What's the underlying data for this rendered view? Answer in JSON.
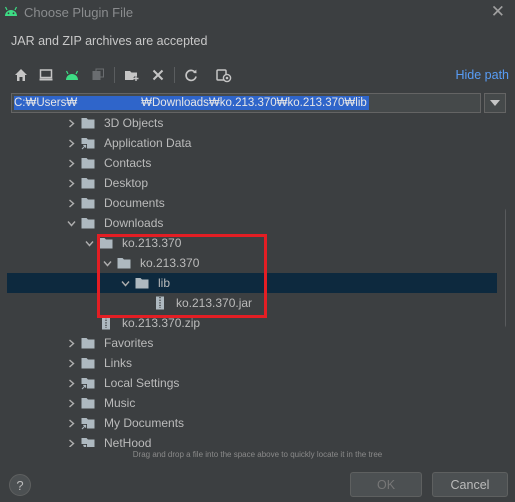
{
  "window": {
    "title": "Choose Plugin File"
  },
  "subtitle": "JAR and ZIP archives are accepted",
  "toolbar": {
    "icons": [
      "home-icon",
      "desktop-icon",
      "android-icon",
      "module-icon",
      "new-folder-icon",
      "delete-icon",
      "refresh-icon",
      "show-hidden-icon"
    ],
    "hide_path_label": "Hide path"
  },
  "path": {
    "value": "C:₩Users₩                    ₩Downloads₩ko.213.370₩ko.213.370₩lib"
  },
  "tree": {
    "rows": [
      {
        "label": "3D Objects",
        "depth": 1,
        "type": "folder",
        "expander": "collapsed"
      },
      {
        "label": "Application Data",
        "depth": 1,
        "type": "folder-shortcut",
        "expander": "collapsed"
      },
      {
        "label": "Contacts",
        "depth": 1,
        "type": "folder",
        "expander": "collapsed"
      },
      {
        "label": "Desktop",
        "depth": 1,
        "type": "folder",
        "expander": "collapsed"
      },
      {
        "label": "Documents",
        "depth": 1,
        "type": "folder",
        "expander": "collapsed"
      },
      {
        "label": "Downloads",
        "depth": 1,
        "type": "folder",
        "expander": "expanded"
      },
      {
        "label": "ko.213.370",
        "depth": 2,
        "type": "folder",
        "expander": "expanded"
      },
      {
        "label": "ko.213.370",
        "depth": 3,
        "type": "folder",
        "expander": "expanded"
      },
      {
        "label": "lib",
        "depth": 4,
        "type": "folder",
        "expander": "expanded",
        "selected": true
      },
      {
        "label": "ko.213.370.jar",
        "depth": 5,
        "type": "archive",
        "expander": "none"
      },
      {
        "label": "ko.213.370.zip",
        "depth": 2,
        "type": "archive",
        "expander": "none"
      },
      {
        "label": "Favorites",
        "depth": 1,
        "type": "folder",
        "expander": "collapsed"
      },
      {
        "label": "Links",
        "depth": 1,
        "type": "folder",
        "expander": "collapsed"
      },
      {
        "label": "Local Settings",
        "depth": 1,
        "type": "folder-shortcut",
        "expander": "collapsed"
      },
      {
        "label": "Music",
        "depth": 1,
        "type": "folder",
        "expander": "collapsed"
      },
      {
        "label": "My Documents",
        "depth": 1,
        "type": "folder-shortcut",
        "expander": "collapsed"
      },
      {
        "label": "NetHood",
        "depth": 1,
        "type": "folder-shortcut",
        "expander": "collapsed"
      }
    ]
  },
  "drag_drop_hint": "Drag and drop a file into the space above to quickly locate it in the tree",
  "buttons": {
    "help": "?",
    "ok": "OK",
    "cancel": "Cancel"
  },
  "colors": {
    "background": "#3c3f41",
    "selection": "#0d293e",
    "path_selection": "#2f65ca",
    "link": "#589df6",
    "highlight_box": "#e31e24",
    "android_green": "#3ddc84",
    "folder": "#aeb9c0"
  }
}
